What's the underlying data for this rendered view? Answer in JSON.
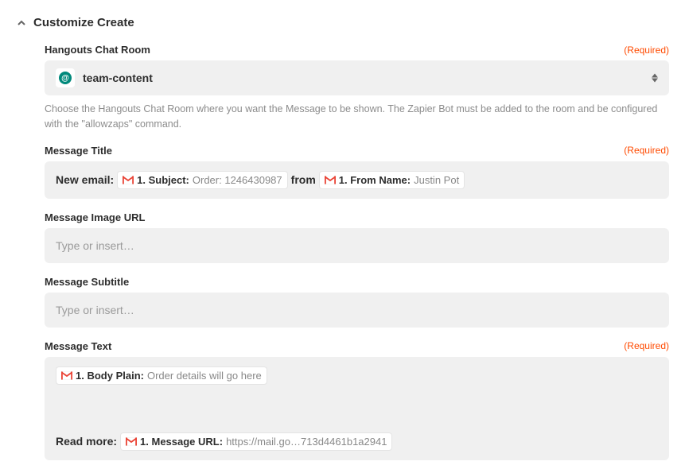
{
  "section": {
    "title": "Customize Create"
  },
  "fields": {
    "chatRoom": {
      "label": "Hangouts Chat Room",
      "required": "(Required)",
      "selectedValue": "team-content",
      "helpText": "Choose the Hangouts Chat Room where you want the Message to be shown. The Zapier Bot must be added to the room and be configured with the \"allowzaps\" command."
    },
    "messageTitle": {
      "label": "Message Title",
      "required": "(Required)",
      "prefix": "New email: ",
      "pill1Label": "1. Subject: ",
      "pill1Value": "Order: 1246430987",
      "middle": " from ",
      "pill2Label": "1. From Name: ",
      "pill2Value": "Justin Pot"
    },
    "messageImageUrl": {
      "label": "Message Image URL",
      "placeholder": "Type or insert…"
    },
    "messageSubtitle": {
      "label": "Message Subtitle",
      "placeholder": "Type or insert…"
    },
    "messageText": {
      "label": "Message Text",
      "required": "(Required)",
      "pill1Label": "1. Body Plain: ",
      "pill1Value": "Order details will go here",
      "readMore": "Read more: ",
      "pill2Label": "1. Message URL: ",
      "pill2Value": "https://mail.go…713d4461b1a2941"
    }
  }
}
